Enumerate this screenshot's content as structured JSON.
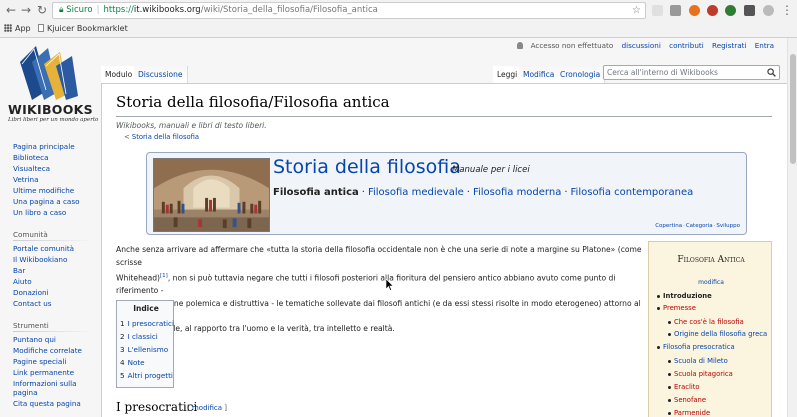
{
  "browser": {
    "secure_label": "Sicuro",
    "url_scheme": "https://",
    "url_host": "it.wikibooks.org",
    "url_path": "/wiki/Storia_della_filosofia/Filosofia_antica",
    "bookmarks": [
      "App",
      "Kjuicer Bookmarklet"
    ]
  },
  "logo": {
    "wordmark": "WIKIBOOKS",
    "tagline": "Libri liberi per un mondo aperto"
  },
  "personal_tools": {
    "not_logged": "Accesso non effettuato",
    "discussions": "discussioni",
    "contributions": "contributi",
    "register": "Registrati",
    "login": "Entra"
  },
  "tabs": {
    "module": "Modulo",
    "discussion": "Discussione",
    "read": "Leggi",
    "edit": "Modifica",
    "history": "Cronologia"
  },
  "search": {
    "placeholder": "Cerca all'interno di Wikibooks"
  },
  "sidebar": {
    "nav": [
      "Pagina principale",
      "Biblioteca",
      "Visualteca",
      "Vetrina",
      "Ultime modifiche",
      "Una pagina a caso",
      "Un libro a caso"
    ],
    "community_head": "Comunità",
    "community": [
      "Portale comunità",
      "Il Wikibookiano",
      "Bar",
      "Aiuto",
      "Donazioni",
      "Contact us"
    ],
    "tools_head": "Strumenti",
    "tools": [
      "Puntano qui",
      "Modifiche correlate",
      "Pagine speciali",
      "Link permanente",
      "Informazioni sulla",
      "pagina",
      "Cita questa pagina"
    ]
  },
  "article": {
    "title": "Storia della filosofia/Filosofia antica",
    "site_sub": "Wikibooks, manuali e libri di testo liberi.",
    "parent_prefix": "<",
    "parent_link": "Storia della filosofia",
    "intro_lines": [
      "Anche senza arrivare ad affermare che «tutta la storia della filosofia occidentale non è che una serie di note a margine su Platone» (come scrisse",
      "Whitehead)",
      ", non si può tuttavia negare che tutti i filosofi posteriori alla fioritura del pensiero antico abbiano avuto come punto di riferimento -",
      "anche in funzione polemica e distruttiva - le tematiche sollevate dai filosofi antichi (e da essi stessi risolte in modo eterogeneo) attorno al fine",
      "dell'agire morale, al rapporto tra l'uomo e la verità, tra intelletto e realtà."
    ],
    "ref_mark": "[1]",
    "h2": "I presocratici",
    "h2_edit_open": "[",
    "h2_edit": "modifica",
    "h2_edit_close": "]"
  },
  "banner": {
    "title": "Storia della filosofia",
    "subtitle": "Manuale per i licei",
    "current": "Filosofia antica",
    "links": [
      "Filosofia medievale",
      "Filosofia moderna",
      "Filosofia contemporanea"
    ],
    "sep": "·",
    "footer": [
      "Copertina",
      "Categoria",
      "Sviluppo"
    ]
  },
  "toc": {
    "title": "Indice",
    "items": [
      {
        "num": "1",
        "label": "I presocratici"
      },
      {
        "num": "2",
        "label": "I classici"
      },
      {
        "num": "3",
        "label": "L'ellenismo"
      },
      {
        "num": "4",
        "label": "Note"
      },
      {
        "num": "5",
        "label": "Altri progetti"
      }
    ]
  },
  "navbox": {
    "title": "Filosofia Antica",
    "edit": "modifica",
    "items": [
      "Introduzione",
      "Premesse",
      "Che cos'è la filosofia",
      "Origine della filosofia greca",
      "Filosofia presocratica",
      "Scuola di Mileto",
      "Scuola pitagorica",
      "Eraclito",
      "Senofane",
      "Parmenide"
    ]
  },
  "colors": {
    "link": "#0645ad",
    "redlink": "#ba0000",
    "content_border": "#a7d7f9",
    "navbox_bg": "#fbf5df",
    "banner_bg": "#f1f4f9"
  }
}
